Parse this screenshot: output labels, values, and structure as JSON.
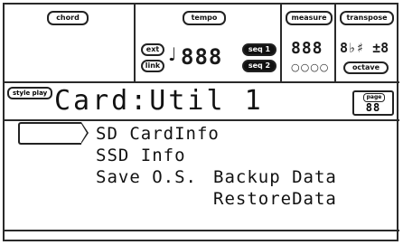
{
  "header": {
    "chord_label": "chord",
    "tempo_label": "tempo",
    "ext_label": "ext",
    "link_label": "link",
    "tempo_value": "888",
    "seq1_label": "seq 1",
    "seq2_label": "seq 2",
    "measure_label": "measure",
    "measure_value": "888",
    "measure_dots": "○○○○",
    "transpose_label": "transpose",
    "transpose_value": "8♭♯ ±8",
    "octave_label": "octave"
  },
  "page": {
    "mode_label": "style play",
    "title": "Card:Util 1",
    "page_label": "page",
    "page_value": "88"
  },
  "menu": {
    "items": [
      {
        "label": "SD CardInfo"
      },
      {
        "label": "SSD Info"
      },
      {
        "label": "Save O.S."
      },
      {
        "label": "Backup Data"
      },
      {
        "label": "RestoreData"
      }
    ]
  }
}
